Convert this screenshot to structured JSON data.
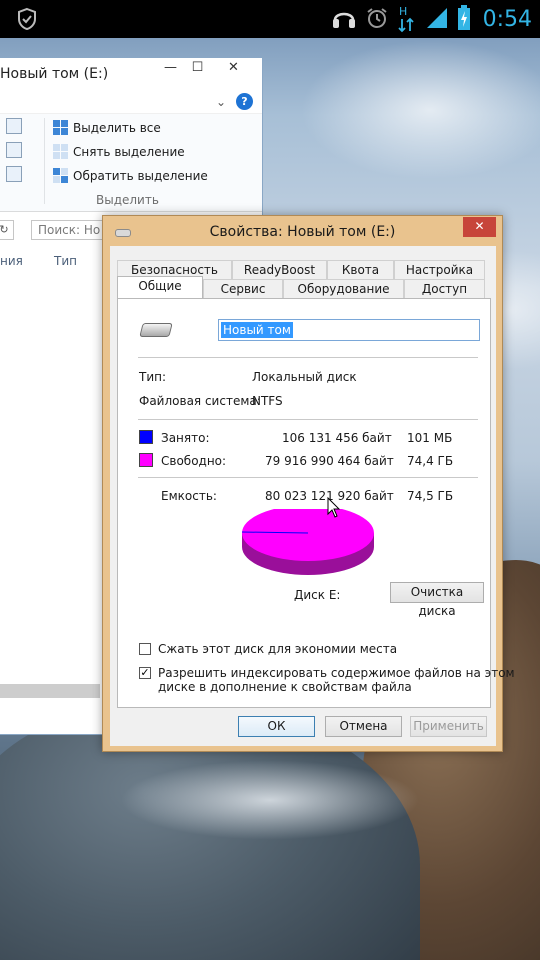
{
  "status_bar": {
    "time": "0:54",
    "network_label": "H",
    "icons": [
      "shield-check-icon",
      "headset-icon",
      "alarm-clock-icon",
      "data-arrows-icon",
      "signal-bars-icon",
      "battery-charging-icon"
    ]
  },
  "explorer": {
    "title": "Новый том (E:)",
    "window_controls": {
      "minimize": "—",
      "maximize": "☐",
      "close": "✕"
    },
    "help": "?",
    "ribbon": {
      "items": [
        "Выделить все",
        "Снять выделение",
        "Обратить выделение"
      ],
      "group_label": "Выделить"
    },
    "search_placeholder": "Поиск: Но",
    "columns": [
      "ния",
      "Тип"
    ]
  },
  "dialog": {
    "title": "Свойства: Новый том (E:)",
    "close": "✕",
    "tabs_row1": [
      "Безопасность",
      "ReadyBoost",
      "Квота",
      "Настройка"
    ],
    "tabs_row2": [
      "Общие",
      "Сервис",
      "Оборудование",
      "Доступ"
    ],
    "active_tab": "Общие",
    "volume_name": "Новый том",
    "type_label": "Тип:",
    "type_value": "Локальный диск",
    "fs_label": "Файловая система:",
    "fs_value": "NTFS",
    "used_label": "Занято:",
    "used_bytes": "106 131 456 байт",
    "used_short": "101 МБ",
    "free_label": "Свободно:",
    "free_bytes": "79 916 990 464 байт",
    "free_short": "74,4 ГБ",
    "capacity_label": "Емкость:",
    "capacity_bytes": "80 023 121 920 байт",
    "capacity_short": "74,5 ГБ",
    "disk_label": "Диск E:",
    "cleanup_button": "Очистка диска",
    "compress_label": "Сжать этот диск для экономии места",
    "compress_checked": false,
    "index_label_line1": "Разрешить индексировать содержимое файлов на этом",
    "index_label_line2": "диске в дополнение к свойствам файла",
    "index_checked": true,
    "ok": "ОК",
    "cancel": "Отмена",
    "apply": "Применить",
    "colors": {
      "used": "#0000ff",
      "free": "#ff00ff",
      "free_dark": "#9a0f9a",
      "titlebar": "#e9c38e",
      "close": "#c7453a"
    }
  }
}
